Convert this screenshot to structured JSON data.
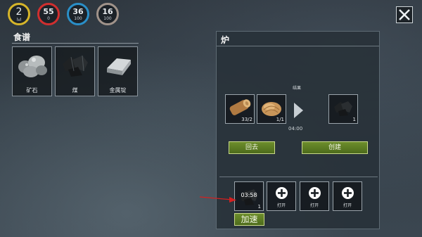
{
  "hud": {
    "level": {
      "value": "2",
      "sub": "lvl"
    },
    "health": {
      "value": "55",
      "sub": "0",
      "color": "#d02f2f"
    },
    "water": {
      "value": "36",
      "sub": "100",
      "color": "#2a8fc8"
    },
    "food": {
      "value": "16",
      "sub": "100",
      "color": "#a0938a"
    },
    "close_icon": "close-icon"
  },
  "recipes": {
    "title": "食谱",
    "items": [
      {
        "label": "矿石",
        "icon": "ore-icon"
      },
      {
        "label": "煤",
        "icon": "coal-icon"
      },
      {
        "label": "金属锭",
        "icon": "metal-ingot-icon"
      }
    ]
  },
  "furnace": {
    "title": "炉",
    "result_label": "结果",
    "inputs": [
      {
        "icon": "wood-log-icon",
        "count": "33/2"
      },
      {
        "icon": "plant-fiber-icon",
        "count": "1/1"
      }
    ],
    "output": {
      "icon": "coal-icon",
      "count": "1"
    },
    "time": "04:00",
    "back_label": "回去",
    "create_label": "创建",
    "queue": [
      {
        "icon": "coal-icon",
        "timer": "03:58",
        "count": "1"
      },
      {
        "label": "打开",
        "icon": "plus-icon"
      },
      {
        "label": "打开",
        "icon": "plus-icon"
      },
      {
        "label": "打开",
        "icon": "plus-icon"
      }
    ],
    "speed_up_label": "加速"
  },
  "colors": {
    "accent_green": "#5c7d24",
    "arrow_red": "#d42020"
  }
}
